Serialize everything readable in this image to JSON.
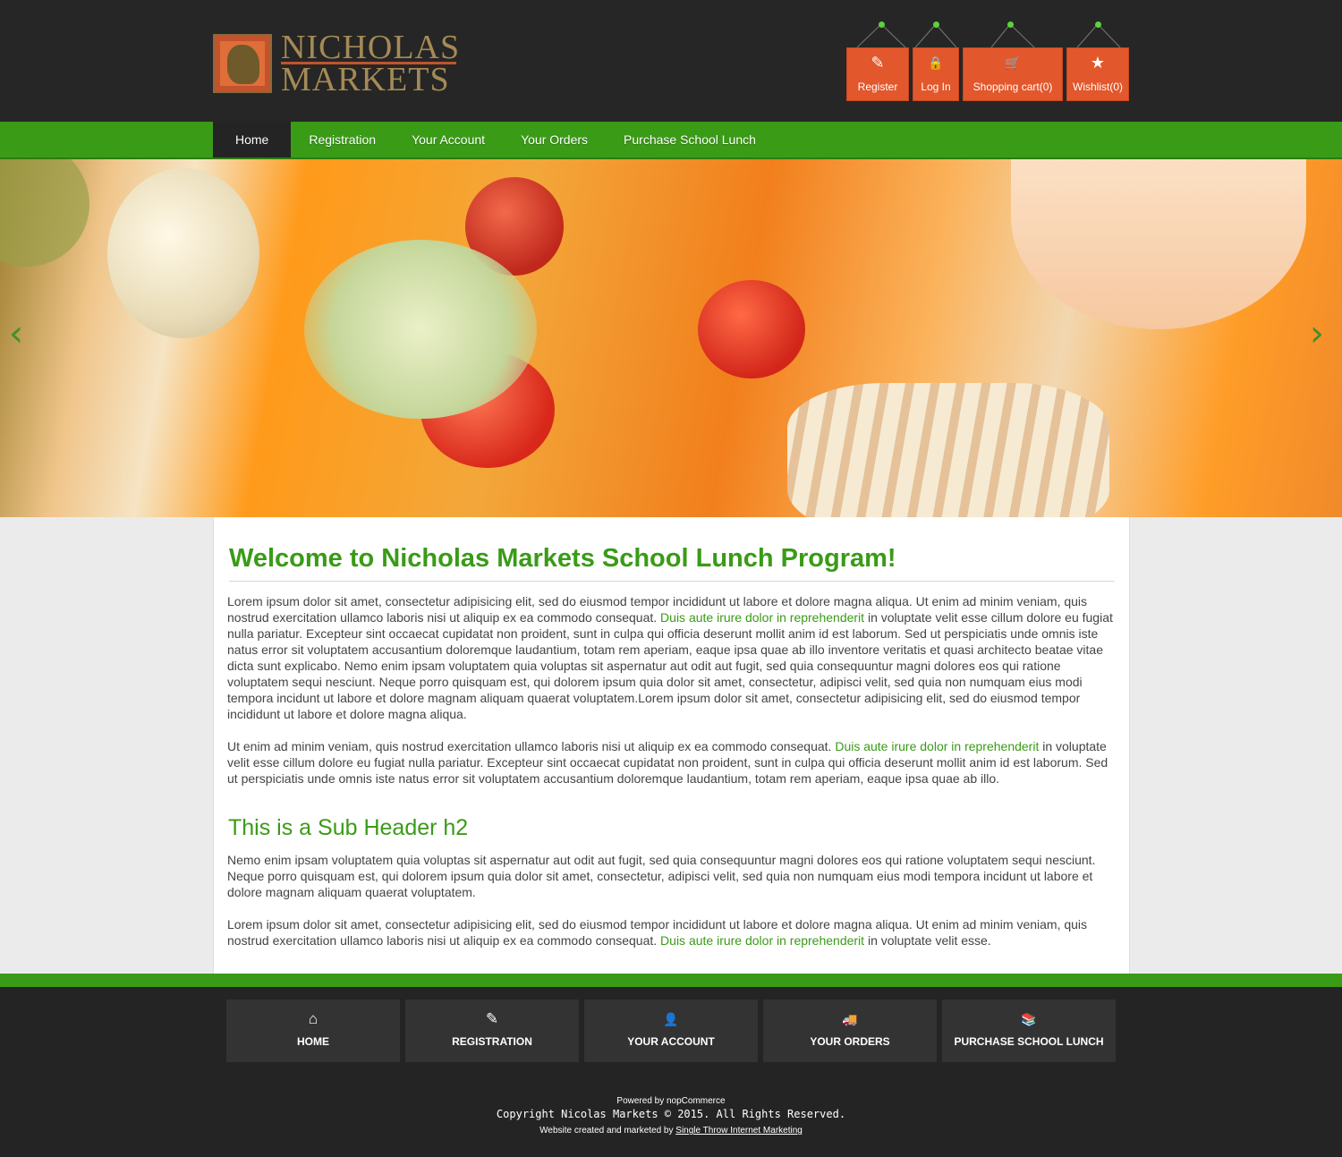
{
  "brand": {
    "line1": "NICHOLAS",
    "line2": "MARKETS"
  },
  "toplinks": [
    {
      "label": "Register",
      "icon": "edit-icon",
      "glyph": "✎"
    },
    {
      "label": "Log In",
      "icon": "lock-icon",
      "glyph": "🔒"
    },
    {
      "label": "Shopping cart(0)",
      "icon": "cart-icon",
      "glyph": "🛒"
    },
    {
      "label": "Wishlist(0)",
      "icon": "star-icon",
      "glyph": "★"
    }
  ],
  "nav": [
    "Home",
    "Registration",
    "Your Account",
    "Your Orders",
    "Purchase School Lunch"
  ],
  "banner": {
    "prev_glyph": "‹",
    "next_glyph": "›"
  },
  "main": {
    "title": "Welcome to Nicholas Markets School Lunch Program!",
    "p1a": "Lorem ipsum dolor sit amet, consectetur adipisicing elit, sed do eiusmod tempor incididunt ut labore et dolore magna aliqua. Ut enim ad minim veniam, quis nostrud exercitation ullamco laboris nisi ut aliquip ex ea commodo consequat. ",
    "p1link": "Duis aute irure dolor in reprehenderit",
    "p1b": " in voluptate velit esse cillum dolore eu fugiat nulla pariatur. Excepteur sint occaecat cupidatat non proident, sunt in culpa qui officia deserunt mollit anim id est laborum. Sed ut perspiciatis unde omnis iste natus error sit voluptatem accusantium doloremque laudantium, totam rem aperiam, eaque ipsa quae ab illo inventore veritatis et quasi architecto beatae vitae dicta sunt explicabo. Nemo enim ipsam voluptatem quia voluptas sit aspernatur aut odit aut fugit, sed quia consequuntur magni dolores eos qui ratione voluptatem sequi nesciunt. Neque porro quisquam est, qui dolorem ipsum quia dolor sit amet, consectetur, adipisci velit, sed quia non numquam eius modi tempora incidunt ut labore et dolore magnam aliquam quaerat voluptatem.Lorem ipsum dolor sit amet, consectetur adipisicing elit, sed do eiusmod tempor incididunt ut labore et dolore magna aliqua.",
    "p2a": "Ut enim ad minim veniam, quis nostrud exercitation ullamco laboris nisi ut aliquip ex ea commodo consequat. ",
    "p2link": "Duis aute irure dolor in reprehenderit",
    "p2b": " in voluptate velit esse cillum dolore eu fugiat nulla pariatur. Excepteur sint occaecat cupidatat non proident, sunt in culpa qui officia deserunt mollit anim id est laborum. Sed ut perspiciatis unde omnis iste natus error sit voluptatem accusantium doloremque laudantium, totam rem aperiam, eaque ipsa quae ab illo.",
    "subheader": "This is a Sub Header h2",
    "p3": "Nemo enim ipsam voluptatem quia voluptas sit aspernatur aut odit aut fugit, sed quia consequuntur magni dolores eos qui ratione voluptatem sequi nesciunt. Neque porro quisquam est, qui dolorem ipsum quia dolor sit amet, consectetur, adipisci velit, sed quia non numquam eius modi tempora incidunt ut labore et dolore magnam aliquam quaerat voluptatem.",
    "p4a": "Lorem ipsum dolor sit amet, consectetur adipisicing elit, sed do eiusmod tempor incididunt ut labore et dolore magna aliqua. Ut enim ad minim veniam, quis nostrud exercitation ullamco laboris nisi ut aliquip ex ea commodo consequat. ",
    "p4link": "Duis aute irure dolor in reprehenderit",
    "p4b": " in voluptate velit esse."
  },
  "footer_nav": [
    {
      "label": "HOME",
      "icon": "home-icon",
      "glyph": "⌂"
    },
    {
      "label": "REGISTRATION",
      "icon": "edit-icon",
      "glyph": "✎"
    },
    {
      "label": "YOUR ACCOUNT",
      "icon": "user-icon",
      "glyph": "👤"
    },
    {
      "label": "YOUR ORDERS",
      "icon": "truck-icon",
      "glyph": "🚚"
    },
    {
      "label": "PURCHASE SCHOOL LUNCH",
      "icon": "books-icon",
      "glyph": "📚"
    }
  ],
  "footer": {
    "powered": "Powered by nopCommerce",
    "copyright": "Copyright Nicolas Markets © 2015. All Rights Reserved.",
    "created_prefix": "Website created and marketed by ",
    "created_link": "Single Throw Internet Marketing"
  },
  "colors": {
    "accent_green": "#3a9b17",
    "button_orange": "#e2572c",
    "dark": "#242424"
  }
}
